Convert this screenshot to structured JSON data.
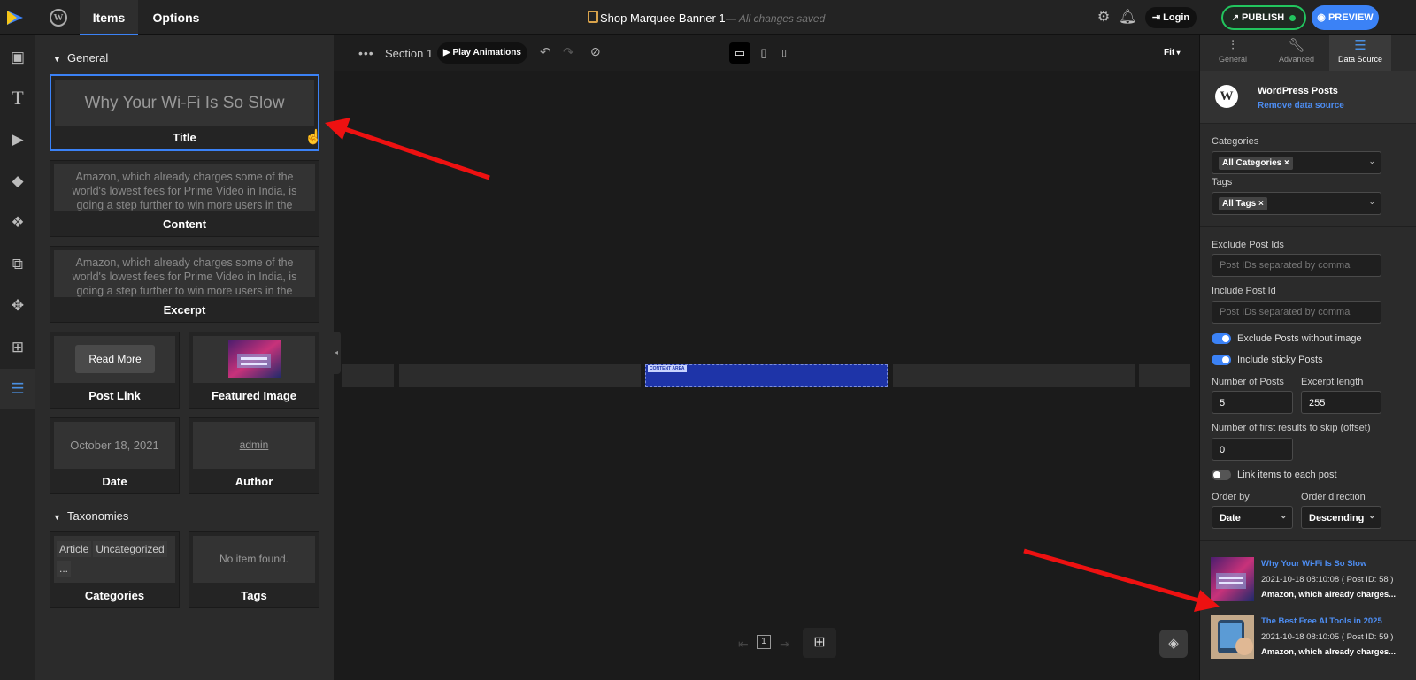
{
  "topbar": {
    "tabs": [
      "Items",
      "Options"
    ],
    "doc_title": "Shop Marquee Banner 1",
    "doc_status": "— All changes saved",
    "login_label": "Login",
    "publish_label": "PUBLISH",
    "preview_label": "PREVIEW",
    "accent": "#3b82f6",
    "publish_color": "#22c55e"
  },
  "rail": {
    "icons": [
      "image-icon",
      "text-icon",
      "video-icon",
      "shapes-icon",
      "widgets-icon",
      "slides-icon",
      "move-icon",
      "add-icon",
      "database-icon"
    ],
    "active": "database-icon"
  },
  "items_panel": {
    "general_label": "General",
    "taxonomies_label": "Taxonomies",
    "title_card": {
      "preview": "Why Your Wi-Fi Is So Slow",
      "label": "Title"
    },
    "content_card": {
      "preview": "Amazon, which already charges some of the world's lowest fees for Prime Video in India, is going a step further to win more users in the world's second...",
      "label": "Content"
    },
    "excerpt_card": {
      "preview": "Amazon, which already charges some of the world's lowest fees for Prime Video in India, is going a step further to win more users in the world's second...",
      "label": "Excerpt"
    },
    "post_link_card": {
      "button": "Read More",
      "label": "Post Link"
    },
    "featured_image_card": {
      "label": "Featured Image"
    },
    "date_card": {
      "preview": "October 18, 2021",
      "label": "Date"
    },
    "author_card": {
      "preview": "admin",
      "label": "Author"
    },
    "categories_card": {
      "chips": [
        "Article",
        "Uncategorized",
        "..."
      ],
      "label": "Categories"
    },
    "tags_card": {
      "preview": "No item found.",
      "label": "Tags"
    }
  },
  "canvas": {
    "section_label": "Section 1",
    "play_label": "Play Animations",
    "zoom": "Fit",
    "content_area_tag": "CONTENT AREA",
    "page_number": "1"
  },
  "right_panel": {
    "tabs": [
      "General",
      "Advanced",
      "Data Source"
    ],
    "active_tab": "Data Source",
    "source_name": "WordPress Posts",
    "remove_label": "Remove data source",
    "categories_label": "Categories",
    "categories_value": "All Categories",
    "tags_label": "Tags",
    "tags_value": "All Tags",
    "exclude_ids_label": "Exclude Post Ids",
    "exclude_ids_placeholder": "Post IDs separated by comma",
    "include_id_label": "Include Post Id",
    "include_id_placeholder": "Post IDs separated by comma",
    "toggle_exclude_noimage": {
      "label": "Exclude Posts without image",
      "on": true
    },
    "toggle_sticky": {
      "label": "Include sticky Posts",
      "on": true
    },
    "num_posts_label": "Number of Posts",
    "num_posts_value": "5",
    "excerpt_length_label": "Excerpt length",
    "excerpt_length_value": "255",
    "offset_label": "Number of first results to skip (offset)",
    "offset_value": "0",
    "toggle_link_items": {
      "label": "Link items to each post",
      "on": false
    },
    "order_by_label": "Order by",
    "order_by_value": "Date",
    "order_dir_label": "Order direction",
    "order_dir_value": "Descending",
    "posts": [
      {
        "title": "Why Your Wi-Fi Is So Slow",
        "meta": "2021-10-18 08:10:08 ( Post ID: 58 )",
        "excerpt": "Amazon, which already charges..."
      },
      {
        "title": "The Best Free AI Tools in 2025",
        "meta": "2021-10-18 08:10:05 ( Post ID: 59 )",
        "excerpt": "Amazon, which already charges..."
      }
    ]
  }
}
